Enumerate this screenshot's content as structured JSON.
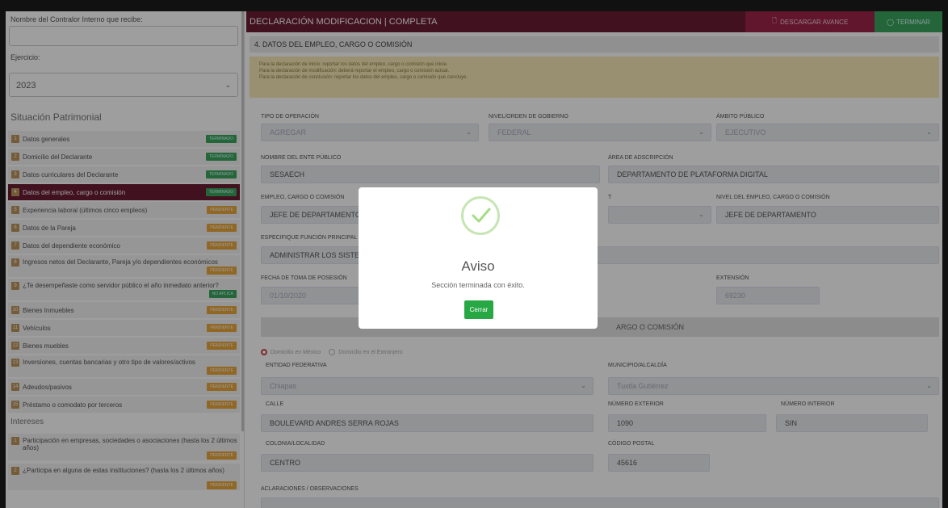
{
  "sidebar": {
    "controller_label": "Nombre del Contralor Interno que recibe:",
    "controller_value": "",
    "period_label": "Ejercicio:",
    "period_value": "2023",
    "section1": "Situación Patrimonial",
    "items": [
      {
        "n": "1",
        "label": "Datos generales",
        "status": "TERMINADO"
      },
      {
        "n": "2",
        "label": "Domicilio del Declarante",
        "status": "TERMINADO"
      },
      {
        "n": "3",
        "label": "Datos curriculares del Declarante",
        "status": "TERMINADO"
      },
      {
        "n": "4",
        "label": "Datos del empleo, cargo o comisión",
        "status": "TERMINADO"
      },
      {
        "n": "5",
        "label": "Experiencia laboral (últimos cinco empleos)",
        "status": "PENDIENTE"
      },
      {
        "n": "6",
        "label": "Datos de la Pareja",
        "status": "PENDIENTE"
      },
      {
        "n": "7",
        "label": "Datos del dependiente económico",
        "status": "PENDIENTE"
      },
      {
        "n": "8",
        "label": "Ingresos netos del Declarante, Pareja y/o dependientes económicos",
        "status": "PENDIENTE"
      },
      {
        "n": "9",
        "label": "¿Te desempeñaste como servidor público el año inmediato anterior?",
        "status": "NO APLICA"
      },
      {
        "n": "10",
        "label": "Bienes Inmuebles",
        "status": "PENDIENTE"
      },
      {
        "n": "11",
        "label": "Vehículos",
        "status": "PENDIENTE"
      },
      {
        "n": "12",
        "label": "Bienes muebles",
        "status": "PENDIENTE"
      },
      {
        "n": "13",
        "label": "Inversiones, cuentas bancarias y otro tipo de valores/activos",
        "status": "PENDIENTE"
      },
      {
        "n": "14",
        "label": "Adeudos/pasivos",
        "status": "PENDIENTE"
      },
      {
        "n": "15",
        "label": "Préstamo o comodato por terceros",
        "status": "PENDIENTE"
      }
    ],
    "section2": "Intereses",
    "items2": [
      {
        "n": "1",
        "label": "Participación en empresas, sociedades o asociaciones (hasta los 2 últimos años)",
        "status": "PENDIENTE"
      },
      {
        "n": "2",
        "label": "¿Participa en alguna de estas instituciones? (hasta los 2 últimos años)",
        "status": "PENDIENTE"
      }
    ]
  },
  "topbar": {
    "title": "DECLARACIÓN MODIFICACION | COMPLETA",
    "download": "DESCARGAR AVANCE",
    "finish": "TERMINAR"
  },
  "section": {
    "title": "4. DATOS DEL EMPLEO, CARGO O COMISIÓN",
    "note1": "Para la declaración de inicio: reportar los datos del empleo, cargo o comisión que inicie.",
    "note2": "Para la declaración de modificación: deberá reportar el empleo, cargo o comisión actual.",
    "note3": "Para la declaración de conclusión: reportar los datos del empleo, cargo o comisión que concluye."
  },
  "form": {
    "tipo_label": "TIPO DE OPERACIÓN",
    "tipo_value": "AGREGAR",
    "nivel_gob_label": "NIVEL/ORDEN DE GOBIERNO",
    "nivel_gob_value": "FEDERAL",
    "ambito_label": "ÁMBITO PÚBLICO",
    "ambito_value": "EJECUTIVO",
    "ente_label": "NOMBRE DEL ENTE PÚBLICO",
    "ente_value": "SESAECH",
    "area_label": "ÁREA DE ADSCRIPCIÓN",
    "area_value": "DEPARTAMENTO DE PLATAFORMA DIGITAL",
    "cargo_label": "EMPLEO, CARGO O COMISIÓN",
    "cargo_value": "JEFE DE DEPARTAMENTO",
    "t_label": "T",
    "nivel_cargo_label": "NIVEL DEL EMPLEO, CARGO O COMISIÓN",
    "nivel_cargo_value": "JEFE DE DEPARTAMENTO",
    "funcion_label": "ESPECIFIQUE FUNCIÓN PRINCIPAL",
    "funcion_value": "ADMINISTRAR LOS SISTEM",
    "fecha_label": "FECHA DE TOMA DE POSESIÓN",
    "fecha_value": "01/10/2020",
    "ext_label": "EXTENSIÓN",
    "ext_value": "69230",
    "domicilio_bar": "ARGO O COMISIÓN",
    "radio_mx": "Domicilio en México",
    "radio_ext": "Domicilio en el Extranjero",
    "entidad_label": "ENTIDAD FEDERATIVA",
    "entidad_value": "Chiapas",
    "municipio_label": "MUNICIPIO/ALCALDÍA",
    "municipio_value": "Tuxtla Gutiérrez",
    "calle_label": "CALLE",
    "calle_value": "BOULEVARD ANDRES SERRA ROJAS",
    "num_ext_label": "NÚMERO EXTERIOR",
    "num_ext_value": "1090",
    "num_int_label": "NÚMERO INTERIOR",
    "num_int_value": "SIN",
    "colonia_label": "COLONIA/LOCALIDAD",
    "colonia_value": "CENTRO",
    "cp_label": "CÓDIGO POSTAL",
    "cp_value": "45616",
    "aclaraciones_label": "ACLARACIONES / OBSERVACIONES"
  },
  "modal": {
    "title": "Aviso",
    "text": "Sección terminada con éxito.",
    "button": "Cerrar"
  }
}
